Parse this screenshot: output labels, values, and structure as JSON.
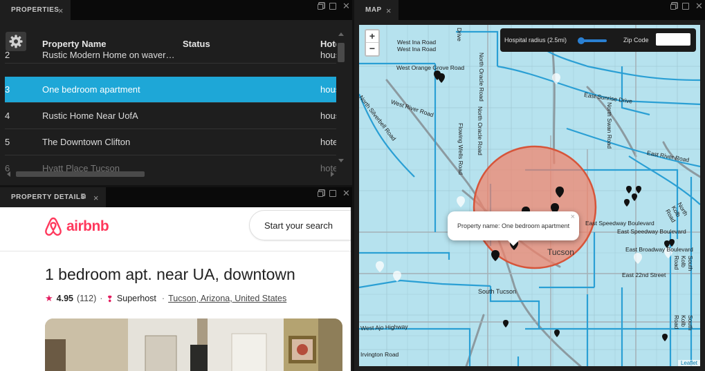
{
  "properties_panel": {
    "tab": "PROPERTIES",
    "columns": [
      "Property Name",
      "Status",
      "Hote"
    ],
    "rows": [
      {
        "id": "2",
        "name": "Rustic Modern Home on waver…",
        "type": "hous"
      },
      {
        "id": "3",
        "name": "One bedroom apartment",
        "type": "hous",
        "selected": true
      },
      {
        "id": "4",
        "name": "Rustic Home Near UofA",
        "type": "hous"
      },
      {
        "id": "5",
        "name": "The Downtown Clifton",
        "type": "hote"
      },
      {
        "id": "6",
        "name": "Hyatt Place Tucson",
        "type": "hote"
      }
    ]
  },
  "details_panel": {
    "tab": "PROPERTY DETAILS",
    "airbnb": {
      "logo_text": "airbnb",
      "search_label": "Start your search",
      "title": "1 bedroom apt. near UA, downtown",
      "rating": "4.95",
      "reviews": "(112)",
      "superhost": "Superhost",
      "location": "Tucson, Arizona, United States",
      "separator": "·"
    }
  },
  "map_panel": {
    "tab": "MAP",
    "zoom_in": "+",
    "zoom_out": "−",
    "radius_label": "Hospital radius (2.5mi)",
    "radius_value": 0.2,
    "zip_label": "Zip Code",
    "zip_value": "",
    "popup_text": "Property name: One bedroom apartment",
    "popup_close": "×",
    "attribution": "Leaflet",
    "labels": {
      "west_ina_1": "West Ina Road",
      "west_ina_2": "West Ina Road",
      "west_orange_grove": "West Orange Grove Road",
      "north_silverbell": "North Silverbell Road",
      "west_river": "West River Road",
      "north_oracle_1": "North Oracle Road",
      "north_oracle_2": "North Oracle Road",
      "flowing_wells": "Flowing Wells Road",
      "east_sunrise": "East Sunrise Drive",
      "north_swan": "North Swan Road",
      "east_river": "East River Road",
      "north_kolb_1": "North Kolb Road",
      "east_speedway_1": "East Speedway Boulevard",
      "east_speedway_2": "East Speedway Boulevard",
      "east_broadway": "East Broadway Boulevard",
      "east_22nd": "East 22nd Street",
      "south_kolb_1": "South Kolb Road",
      "south_kolb_2": "South Kolb Road",
      "tucson": "Tucson",
      "south_tucson": "South Tucson",
      "west_ajo": "West Ajo Highway",
      "irvington": "Irvington Road",
      "drive_partial": "Drive"
    }
  }
}
